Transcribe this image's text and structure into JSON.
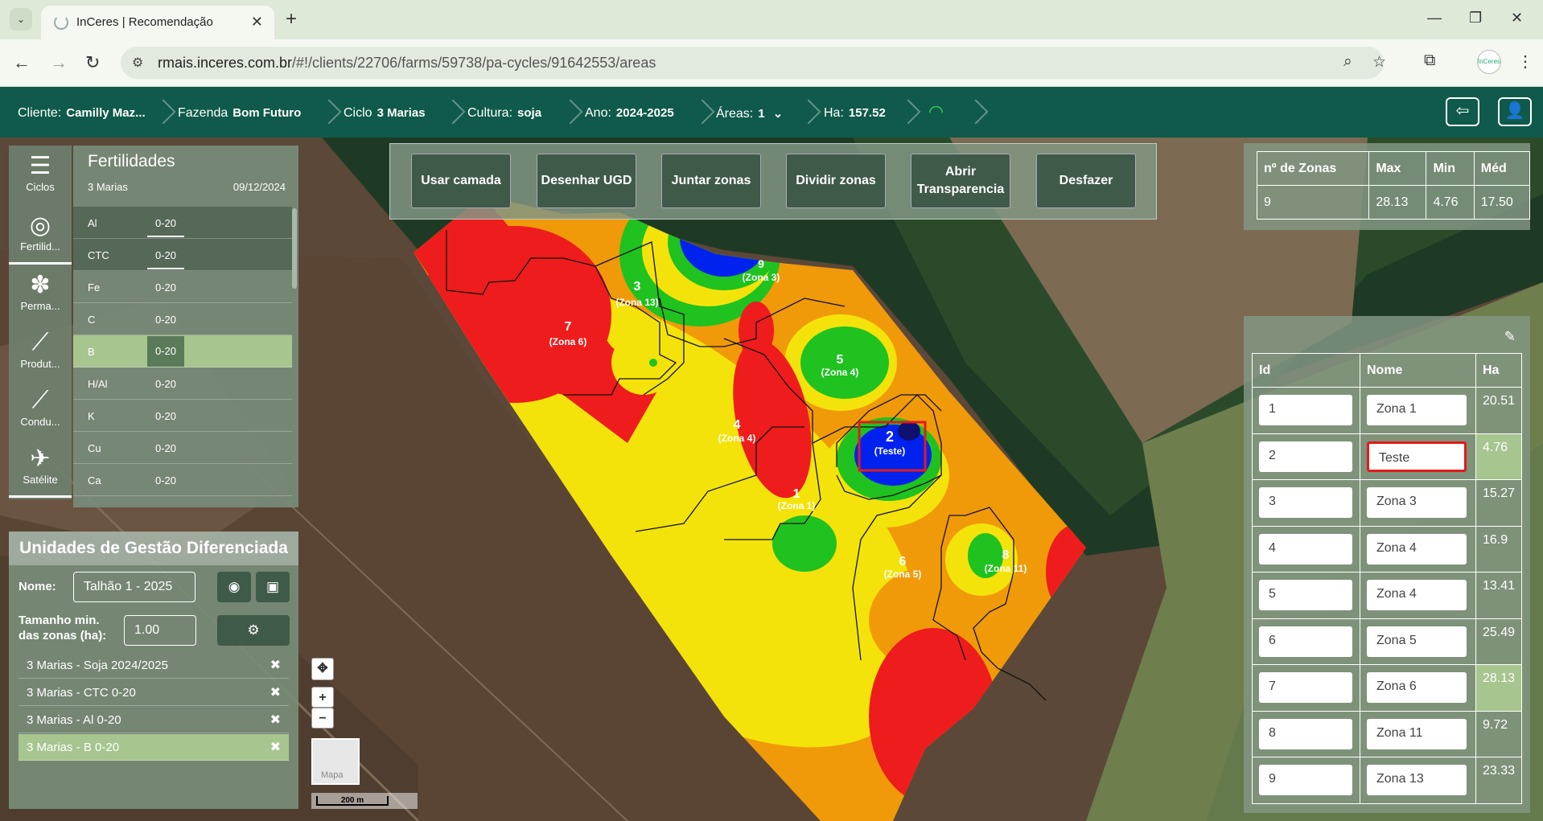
{
  "browser": {
    "tab_title": "InCeres | Recomendação",
    "url_host": "rmais.inceres.com.br",
    "url_path": "/#!/clients/22706/farms/59738/pa-cycles/91642553/areas",
    "profile_label": "InCeres"
  },
  "header": {
    "crumbs": [
      {
        "label": "Cliente:",
        "value": "Camilly Maz..."
      },
      {
        "label": "Fazenda",
        "value": "Bom Futuro"
      },
      {
        "label": "Ciclo",
        "value": "3 Marias"
      },
      {
        "label": "Cultura:",
        "value": "soja"
      },
      {
        "label": "Ano:",
        "value": "2024-2025"
      },
      {
        "label": "Áreas:",
        "value": "1"
      },
      {
        "label": "Ha:",
        "value": "157.52"
      }
    ]
  },
  "sidenav": [
    {
      "label": "Ciclos",
      "icon": "list-icon"
    },
    {
      "label": "Fertilid...",
      "icon": "fertility-icon"
    },
    {
      "label": "Perma...",
      "icon": "plants-icon"
    },
    {
      "label": "Produt...",
      "icon": "chart-icon"
    },
    {
      "label": "Condu...",
      "icon": "chart-icon"
    },
    {
      "label": "Satélite",
      "icon": "satellite-icon"
    }
  ],
  "fertilidades": {
    "title": "Fertilidades",
    "subtitle": "3 Marias",
    "date": "09/12/2024",
    "rows": [
      {
        "key": "Al",
        "value": "0-20"
      },
      {
        "key": "CTC",
        "value": "0-20"
      },
      {
        "key": "Fe",
        "value": "0-20"
      },
      {
        "key": "C",
        "value": "0-20"
      },
      {
        "key": "B",
        "value": "0-20"
      },
      {
        "key": "H/Al",
        "value": "0-20"
      },
      {
        "key": "K",
        "value": "0-20"
      },
      {
        "key": "Cu",
        "value": "0-20"
      },
      {
        "key": "Ca",
        "value": "0-20"
      }
    ]
  },
  "ugd": {
    "title": "Unidades de Gestão Diferenciada",
    "name_label": "Nome:",
    "name_value": "Talhão 1 - 2025",
    "size_label_1": "Tamanho min.",
    "size_label_2": "das zonas (ha):",
    "size_value": "1.00",
    "layers": [
      "3 Marias - Soja 2024/2025",
      "3 Marias - CTC 0-20",
      "3 Marias - Al 0-20",
      "3 Marias - B 0-20"
    ]
  },
  "toolbar": [
    {
      "label": "Usar camada"
    },
    {
      "label": "Desenhar UGD"
    },
    {
      "label": "Juntar zonas"
    },
    {
      "label": "Dividir zonas"
    },
    {
      "label": "Abrir Transparencia"
    },
    {
      "label": "Desfazer"
    }
  ],
  "stats": {
    "headers": [
      "nº de Zonas",
      "Max",
      "Min",
      "Méd"
    ],
    "values": [
      "9",
      "28.13",
      "4.76",
      "17.50"
    ]
  },
  "zones": {
    "headers": [
      "Id",
      "Nome",
      "Ha"
    ],
    "rows": [
      {
        "id": "1",
        "name": "Zona 1",
        "ha": "20.51"
      },
      {
        "id": "2",
        "name": "Teste",
        "ha": "4.76"
      },
      {
        "id": "3",
        "name": "Zona 3",
        "ha": "15.27"
      },
      {
        "id": "4",
        "name": "Zona 4",
        "ha": "16.9"
      },
      {
        "id": "5",
        "name": "Zona 4",
        "ha": "13.41"
      },
      {
        "id": "6",
        "name": "Zona 5",
        "ha": "25.49"
      },
      {
        "id": "7",
        "name": "Zona 6",
        "ha": "28.13"
      },
      {
        "id": "8",
        "name": "Zona 11",
        "ha": "9.72"
      },
      {
        "id": "9",
        "name": "Zona 13",
        "ha": "23.33"
      }
    ]
  },
  "map": {
    "scale_label": "200 m",
    "thumb_label": "Mapa",
    "labels": [
      {
        "num": "3",
        "name": "(Zona 13)"
      },
      {
        "num": "7",
        "name": "(Zona 6)"
      },
      {
        "num": "5",
        "name": "(Zona 4)"
      },
      {
        "num": "4",
        "name": "(Zona 4)"
      },
      {
        "num": "2",
        "name": "(Teste)"
      },
      {
        "num": "1",
        "name": "(Zona 1)"
      },
      {
        "num": "6",
        "name": "(Zona 5)"
      },
      {
        "num": "8",
        "name": "(Zona 11)"
      },
      {
        "num": "9",
        "name": "(Zona 3)"
      }
    ]
  }
}
